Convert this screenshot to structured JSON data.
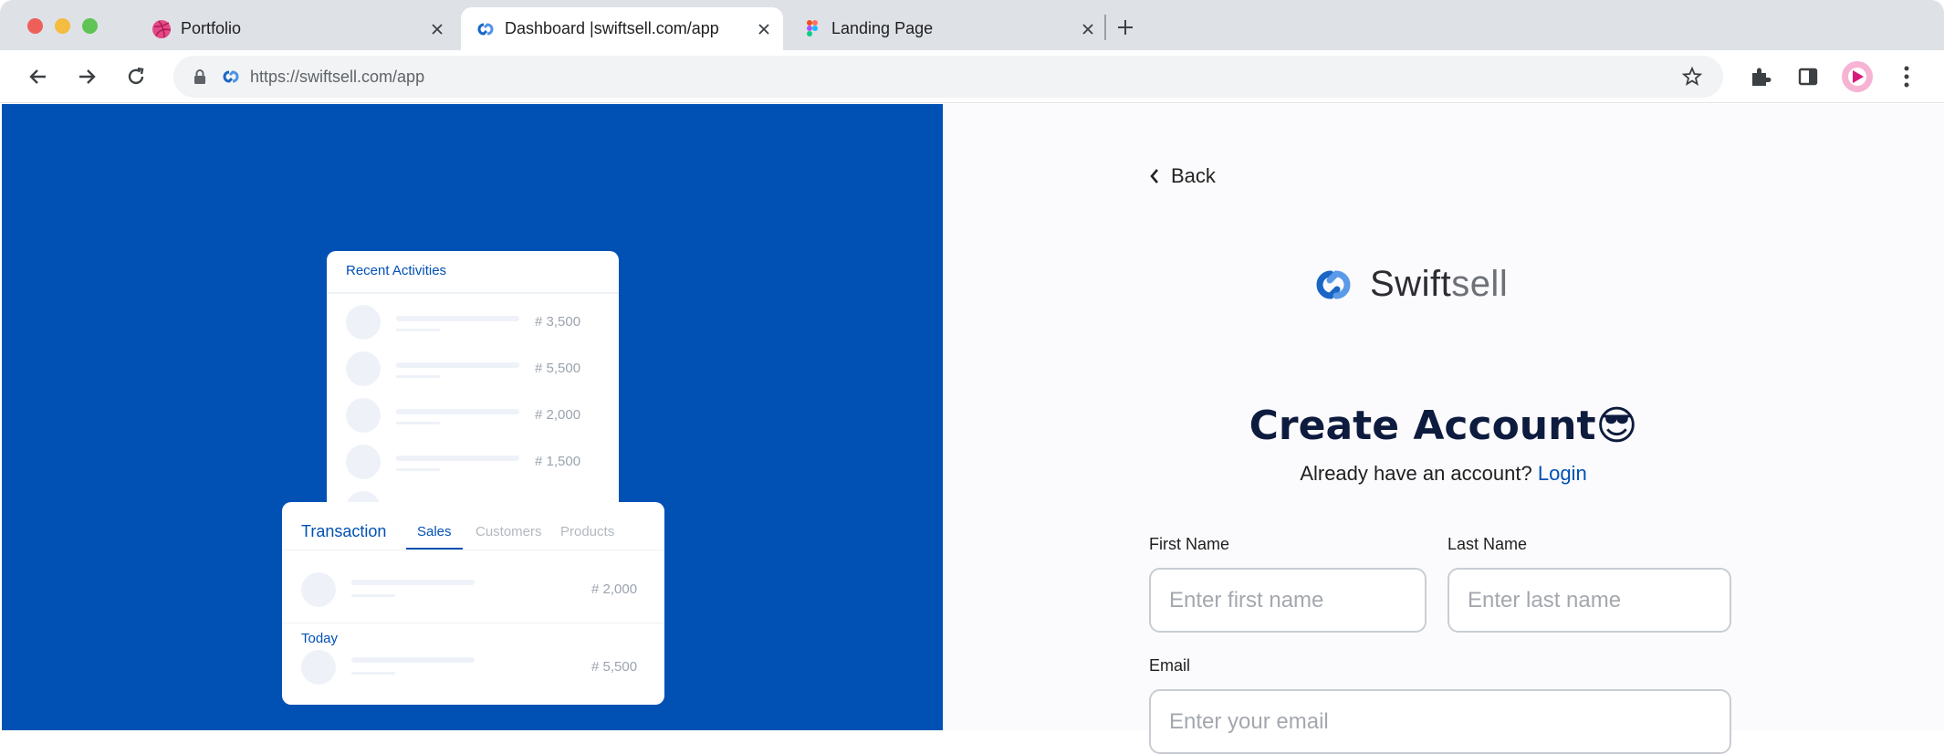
{
  "browser": {
    "tabs": [
      {
        "label": "Portfolio",
        "active": false
      },
      {
        "label": "Dashboard |swiftsell.com/app",
        "active": true
      },
      {
        "label": "Landing Page",
        "active": false
      }
    ],
    "url": "https://swiftsell.com/app"
  },
  "illustration": {
    "activities_card": {
      "title": "Recent Activities",
      "amounts": [
        "# 3,500",
        "# 5,500",
        "# 2,000",
        "# 1,500"
      ]
    },
    "transaction_card": {
      "title": "Transaction",
      "tabs": [
        "Sales",
        "Customers",
        "Products"
      ],
      "active_tab": "Sales",
      "rows": [
        {
          "amount": "# 2,000"
        },
        {
          "group": "Today",
          "amount": "# 5,500"
        }
      ]
    }
  },
  "signup": {
    "back_label": "Back",
    "logo": {
      "part1": "Swift",
      "part2": "sell"
    },
    "heading": "Create Account😎",
    "subline_text": "Already have an account?",
    "login_link": "Login",
    "first_name": {
      "label": "First Name",
      "placeholder": "Enter first name"
    },
    "last_name": {
      "label": "Last Name",
      "placeholder": "Enter last name"
    },
    "email": {
      "label": "Email",
      "placeholder": "Enter your email"
    }
  },
  "colors": {
    "brand": "#0151b5",
    "heading": "#0d1b3e"
  }
}
